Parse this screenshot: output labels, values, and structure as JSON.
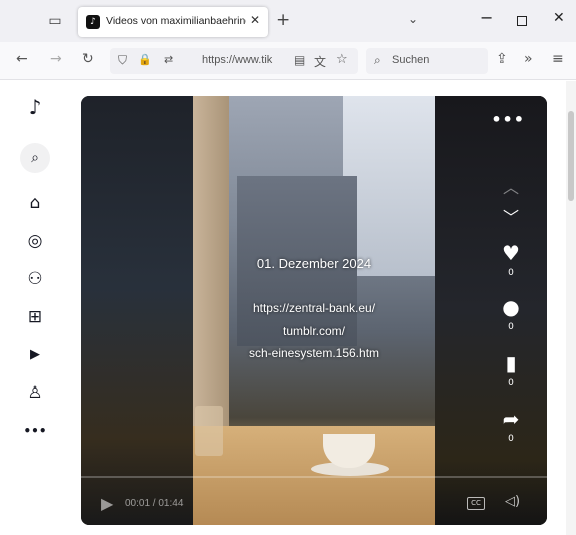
{
  "browser": {
    "tab_title": "Videos von maximilianbaehring",
    "tab_close": "✕",
    "new_tab": "+",
    "list_tabs": "⌄",
    "url": "https://www.tik",
    "search_placeholder": "Suchen",
    "icons": {
      "overview": "▭",
      "back": "←",
      "forward": "→",
      "reload": "↻",
      "shield": "⛉",
      "lock": "🔒",
      "permissions": "⇄",
      "reader": "▤",
      "translate": "文",
      "bookmark_star": "☆",
      "search": "⌕",
      "share": "⇪",
      "overflow": "»",
      "menu": "≡",
      "minimize": "−",
      "close": "✕"
    }
  },
  "sidebar": {
    "logo": "♪",
    "items": [
      {
        "icon": "⌕",
        "name": "search"
      },
      {
        "icon": "⌂",
        "name": "home"
      },
      {
        "icon": "◎",
        "name": "explore"
      },
      {
        "icon": "⚇",
        "name": "following"
      },
      {
        "icon": "⊞",
        "name": "upload"
      },
      {
        "icon": "▶",
        "name": "live"
      },
      {
        "icon": "♙",
        "name": "profile"
      },
      {
        "icon": "•••",
        "name": "more"
      }
    ]
  },
  "video": {
    "overlay": {
      "date": "01. Dezember 2024",
      "url_line1": "https://zentral-bank.eu/",
      "url_line2": "tumblr.com/",
      "url_line3": "sch-einesystem.156.htm"
    },
    "more": "•••",
    "nav_up": "︿",
    "nav_down": "﹀",
    "actions": [
      {
        "icon": "♥",
        "count": "0",
        "name": "like"
      },
      {
        "icon": "●",
        "count": "0",
        "name": "comment"
      },
      {
        "icon": "▮",
        "count": "0",
        "name": "favorite"
      },
      {
        "icon": "➦",
        "count": "0",
        "name": "share"
      }
    ],
    "controls": {
      "play": "▶",
      "time": "00:01 / 01:44",
      "cc": "CC",
      "volume": "◁)"
    }
  },
  "colors": {
    "accent": "#fe2c55",
    "chrome": "#f0f0f4",
    "text": "#161823"
  }
}
